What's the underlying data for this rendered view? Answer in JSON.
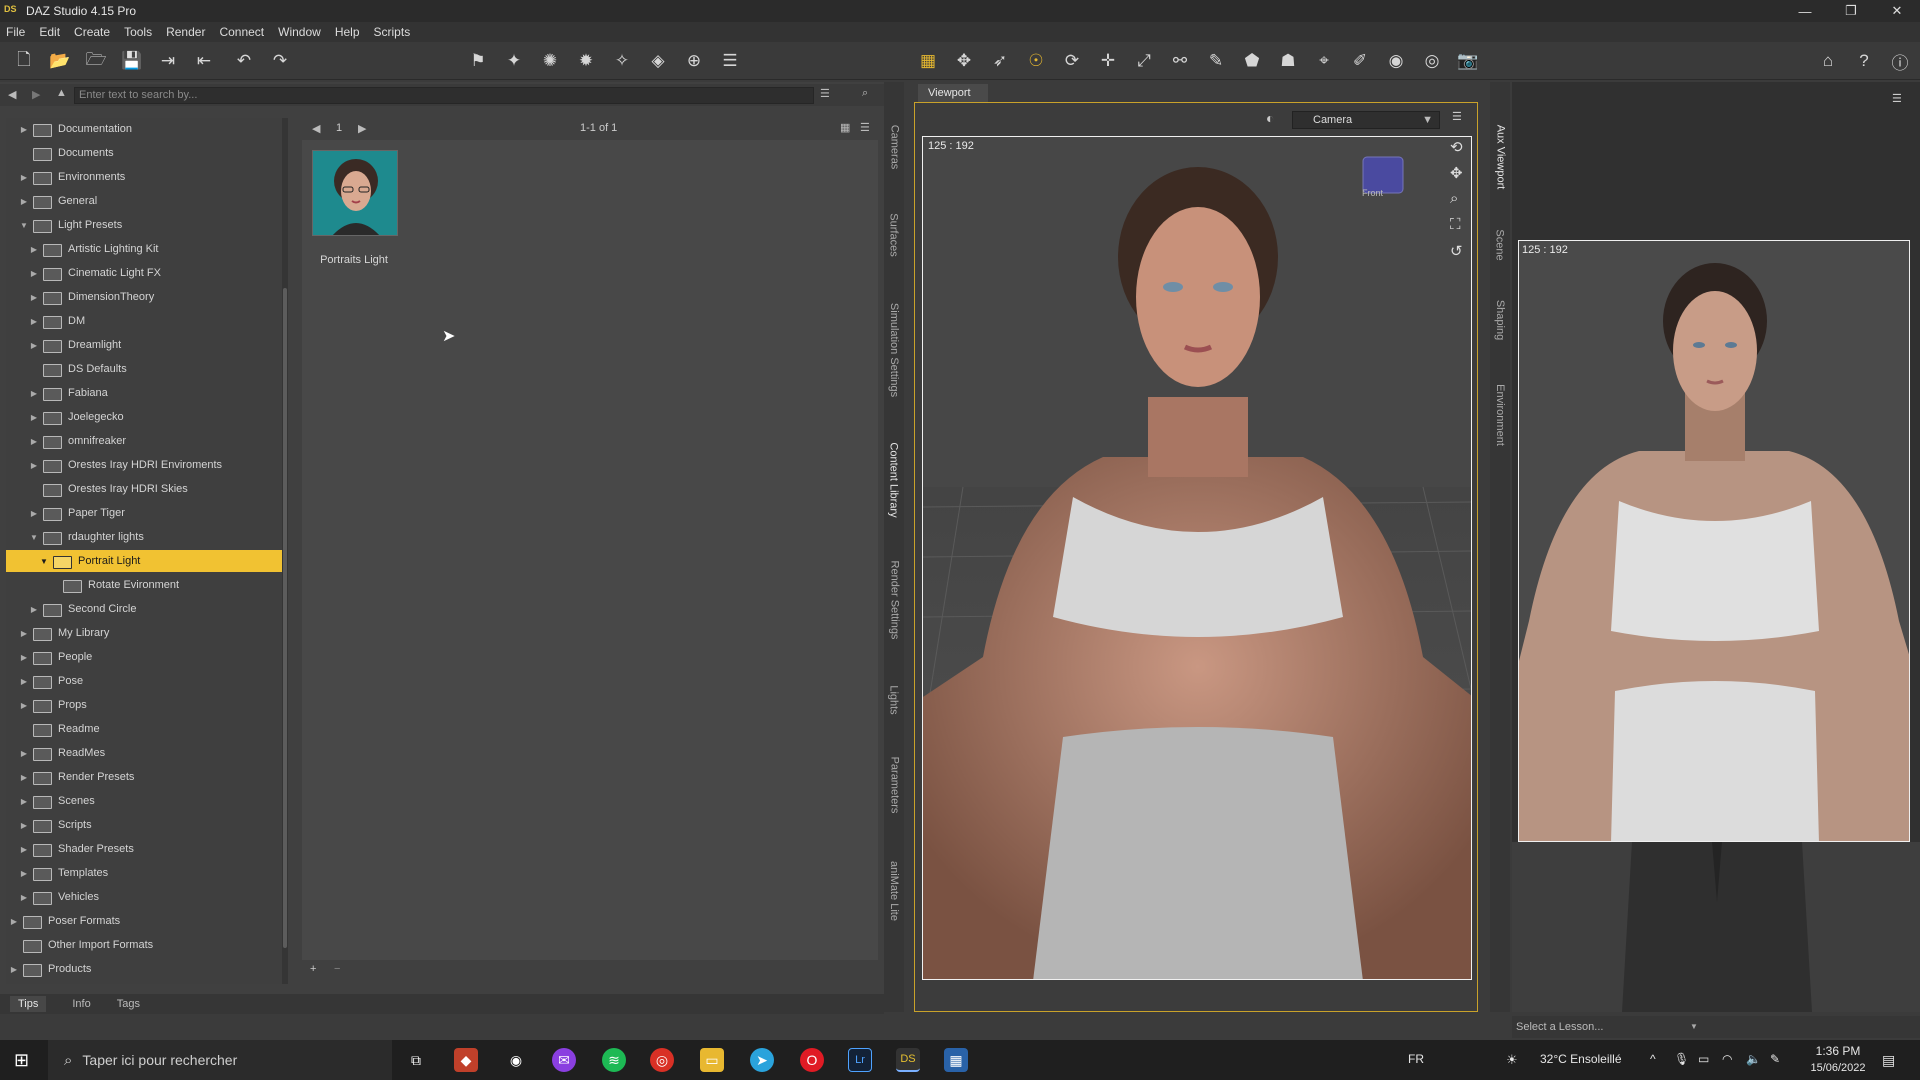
{
  "window": {
    "title": "DAZ Studio 4.15 Pro",
    "logo": "DS"
  },
  "menu": [
    "File",
    "Edit",
    "Create",
    "Tools",
    "Render",
    "Connect",
    "Window",
    "Help",
    "Scripts"
  ],
  "search": {
    "placeholder": "Enter text to search by..."
  },
  "pager": {
    "page": "1",
    "range": "1-1 of 1"
  },
  "tree": [
    {
      "label": "Documentation",
      "level": 1,
      "arrow": "▶"
    },
    {
      "label": "Documents",
      "level": 1,
      "arrow": ""
    },
    {
      "label": "Environments",
      "level": 1,
      "arrow": "▶"
    },
    {
      "label": "General",
      "level": 1,
      "arrow": "▶"
    },
    {
      "label": "Light Presets",
      "level": 1,
      "arrow": "▼"
    },
    {
      "label": "Artistic Lighting Kit",
      "level": 2,
      "arrow": "▶"
    },
    {
      "label": "Cinematic Light FX",
      "level": 2,
      "arrow": "▶"
    },
    {
      "label": "DimensionTheory",
      "level": 2,
      "arrow": "▶"
    },
    {
      "label": "DM",
      "level": 2,
      "arrow": "▶"
    },
    {
      "label": "Dreamlight",
      "level": 2,
      "arrow": "▶"
    },
    {
      "label": "DS Defaults",
      "level": 2,
      "arrow": ""
    },
    {
      "label": "Fabiana",
      "level": 2,
      "arrow": "▶"
    },
    {
      "label": "Joelegecko",
      "level": 2,
      "arrow": "▶"
    },
    {
      "label": "omnifreaker",
      "level": 2,
      "arrow": "▶"
    },
    {
      "label": "Orestes Iray HDRI Enviroments",
      "level": 2,
      "arrow": "▶"
    },
    {
      "label": "Orestes Iray HDRI Skies",
      "level": 2,
      "arrow": ""
    },
    {
      "label": "Paper Tiger",
      "level": 2,
      "arrow": "▶"
    },
    {
      "label": "rdaughter lights",
      "level": 2,
      "arrow": "▼"
    },
    {
      "label": "Portrait Light",
      "level": 3,
      "arrow": "▼",
      "selected": true
    },
    {
      "label": "Rotate Evironment",
      "level": 4,
      "arrow": ""
    },
    {
      "label": "Second Circle",
      "level": 2,
      "arrow": "▶"
    },
    {
      "label": "My Library",
      "level": 1,
      "arrow": "▶"
    },
    {
      "label": "People",
      "level": 1,
      "arrow": "▶"
    },
    {
      "label": "Pose",
      "level": 1,
      "arrow": "▶"
    },
    {
      "label": "Props",
      "level": 1,
      "arrow": "▶"
    },
    {
      "label": "Readme",
      "level": 1,
      "arrow": ""
    },
    {
      "label": "ReadMes",
      "level": 1,
      "arrow": "▶"
    },
    {
      "label": "Render Presets",
      "level": 1,
      "arrow": "▶"
    },
    {
      "label": "Scenes",
      "level": 1,
      "arrow": "▶"
    },
    {
      "label": "Scripts",
      "level": 1,
      "arrow": "▶"
    },
    {
      "label": "Shader Presets",
      "level": 1,
      "arrow": "▶"
    },
    {
      "label": "Templates",
      "level": 1,
      "arrow": "▶"
    },
    {
      "label": "Vehicles",
      "level": 1,
      "arrow": "▶"
    },
    {
      "label": "Poser Formats",
      "level": 0,
      "arrow": "▶"
    },
    {
      "label": "Other Import Formats",
      "level": 0,
      "arrow": ""
    },
    {
      "label": "Products",
      "level": 0,
      "arrow": "▶"
    }
  ],
  "content": {
    "item_label": "Portraits Light"
  },
  "bottom_tabs": [
    "Tips",
    "Info",
    "Tags"
  ],
  "side_tabs": [
    "Cameras",
    "Surfaces",
    "Simulation Settings",
    "Content Library",
    "Render Settings",
    "Lights",
    "Parameters",
    "aniMate Lite"
  ],
  "right_tabs": [
    "Aux Viewport",
    "Scene",
    "Shaping",
    "Environment"
  ],
  "viewport": {
    "tab": "Viewport",
    "camera": "Camera",
    "resolution": "125 : 192",
    "cube_label": "Front"
  },
  "aux": {
    "resolution": "125 : 192",
    "lesson_placeholder": "Select a Lesson..."
  },
  "taskbar": {
    "search_placeholder": "Taper ici pour rechercher",
    "lang": "FR",
    "weather": "32°C  Ensoleillé",
    "time": "1:36 PM",
    "date": "15/06/2022"
  },
  "colors": {
    "selection": "#f1c232",
    "viewport_border": "#c9a22a",
    "accent_gold": "#e6b830"
  }
}
